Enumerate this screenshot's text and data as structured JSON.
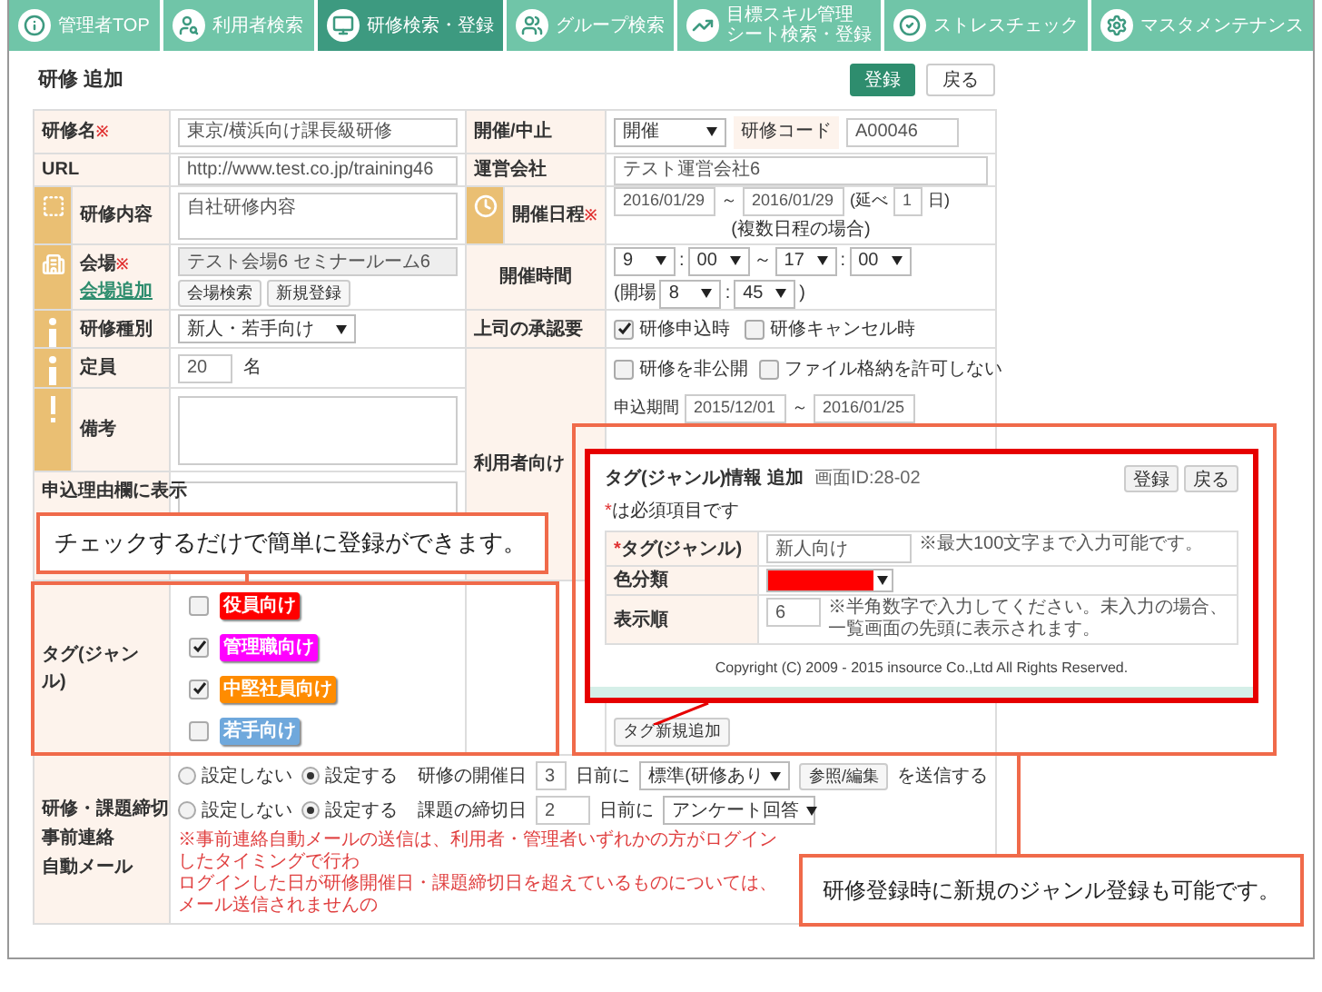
{
  "nav": {
    "tabs": [
      {
        "lines": [
          "管理者TOP"
        ],
        "selected": false
      },
      {
        "lines": [
          "利用者検索"
        ],
        "selected": false
      },
      {
        "lines": [
          "研修検索・登録"
        ],
        "selected": true
      },
      {
        "lines": [
          "グループ検索"
        ],
        "selected": false
      },
      {
        "lines": [
          "目標スキル管理",
          "シート検索・登録"
        ],
        "selected": false
      },
      {
        "lines": [
          "ストレスチェック"
        ],
        "selected": false
      },
      {
        "lines": [
          "マスタメンテナンス"
        ],
        "selected": false
      }
    ]
  },
  "header": {
    "title": "研修 追加",
    "buttons": [
      {
        "label": "登録",
        "kind": "primary"
      },
      {
        "label": "戻る",
        "kind": "plain"
      }
    ]
  },
  "form": {
    "name": {
      "label": "研修名",
      "mark": "※",
      "value": "東京/横浜向け課長級研修"
    },
    "status": {
      "label": "開催/中止",
      "value": "開催"
    },
    "code": {
      "label": "研修コード",
      "value": "A00046"
    },
    "url": {
      "label": "URL",
      "value": "http://www.test.co.jp/training46"
    },
    "company": {
      "label": "運営会社",
      "value": "テスト運営会社6"
    },
    "content": {
      "label": "研修内容",
      "value": "自社研修内容"
    },
    "schedule": {
      "label": "開催日程",
      "mark": "※",
      "from": "2016/01/29",
      "sep": "～",
      "to": "2016/01/29",
      "days_prefix": "(延べ",
      "days": "1",
      "days_suffix": "日)",
      "note": "(複数日程の場合)"
    },
    "venue": {
      "label": "会場",
      "mark": "※",
      "link": "会場追加",
      "value": "テスト会場6 セミナールーム6",
      "buttons": [
        "会場検索",
        "新規登録"
      ]
    },
    "time": {
      "label": "開催時間",
      "start_h": "9",
      "start_m": "00",
      "sep": "～",
      "end_h": "17",
      "end_m": "00",
      "colon": ":",
      "open_prefix": "(開場",
      "open_h": "8",
      "open_m": "45",
      "open_suffix": ")"
    },
    "category": {
      "label": "研修種別",
      "value": "新人・若手向け"
    },
    "approval": {
      "label": "上司の承認要",
      "options": [
        {
          "label": "研修申込時",
          "checked": true
        },
        {
          "label": "研修キャンセル時",
          "checked": false
        }
      ]
    },
    "capacity": {
      "label": "定員",
      "value": "20",
      "unit": "名"
    },
    "audience": {
      "label": "利用者向け",
      "options": [
        {
          "label": "研修を非公開",
          "checked": false
        },
        {
          "label": "ファイル格納を許可しない",
          "checked": false
        }
      ],
      "period_label": "申込期間",
      "period_from": "2015/12/01",
      "period_sep": "～",
      "period_to": "2016/01/25"
    },
    "remarks": {
      "label": "備考"
    },
    "reason": {
      "label": "申込理由欄に表示"
    },
    "tags": {
      "label": "タグ(ジャンル)",
      "items": [
        {
          "label": "役員向け",
          "checked": false,
          "color": "#ff0000"
        },
        {
          "label": "管理職向け",
          "checked": true,
          "color": "#ff00ff"
        },
        {
          "label": "中堅社員向け",
          "checked": true,
          "color": "#ff8c00"
        },
        {
          "label": "若手向け",
          "checked": false,
          "color": "#6fa8dc"
        }
      ],
      "add_button": "タグ新規追加"
    },
    "auto_mail": {
      "label_lines": [
        "研修・課題締切",
        "事前連絡",
        "自動メール"
      ],
      "rows": [
        {
          "options": [
            {
              "label": "設定しない",
              "selected": false
            },
            {
              "label": "設定する",
              "selected": true
            }
          ],
          "target": "研修の開催日",
          "days": "3",
          "suffix": "日前に",
          "template": "標準(研修あり",
          "edit_button": "参照/編集",
          "send": "を送信する"
        },
        {
          "options": [
            {
              "label": "設定しない",
              "selected": false
            },
            {
              "label": "設定する",
              "selected": true
            }
          ],
          "target": "課題の締切日",
          "days": "2",
          "suffix": "日前に",
          "template": "アンケート回答"
        }
      ],
      "note_lines": [
        "※事前連絡自動メールの送信は、利用者・管理者いずれかの方がログインしたタイミングで行わ",
        "ログインした日が研修開催日・課題締切日を超えているものについては、メール送信されませんの"
      ]
    }
  },
  "tag_screen": {
    "title": "タグ(ジャンル)情報 追加",
    "screen_id": "画面ID:28-02",
    "buttons": [
      "登録",
      "戻る"
    ],
    "required_mark": "*",
    "required_note": "は必須項目です",
    "rows": [
      {
        "kind": "text",
        "mark": "*",
        "label": "タグ(ジャンル)",
        "value": "新人向け",
        "note": "※最大100文字まで入力可能です。"
      },
      {
        "kind": "color",
        "label": "色分類",
        "color": "#ff0000"
      },
      {
        "kind": "number",
        "label": "表示順",
        "value": "6",
        "note": "※半角数字で入力してください。未入力の場合、一覧画面の先頭に表示されます。"
      }
    ],
    "copyright": "Copyright (C) 2009 - 2015 insource Co.,Ltd All Rights Reserved."
  },
  "callouts": [
    "チェックするだけで簡単に登録ができます。",
    "研修登録時に新規のジャンル登録も可能です。"
  ]
}
